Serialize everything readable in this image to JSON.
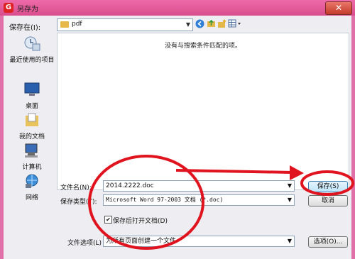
{
  "window": {
    "title": "另存为",
    "close_glyph": "✕"
  },
  "toolbar": {
    "savein_label": "保存在(I):",
    "savein_value": "pdf",
    "buttons": [
      "back-icon",
      "up-folder-icon",
      "new-folder-icon",
      "views-menu-icon"
    ]
  },
  "sidebar": {
    "items": [
      {
        "label": "最近使用的项目",
        "icon": "recent-items-icon"
      },
      {
        "label": "桌面",
        "icon": "desktop-icon"
      },
      {
        "label": "我的文档",
        "icon": "my-documents-icon"
      },
      {
        "label": "计算机",
        "icon": "computer-icon"
      },
      {
        "label": "网络",
        "icon": "network-icon"
      }
    ]
  },
  "filelist": {
    "empty_message": "没有与搜索条件匹配的项。"
  },
  "form": {
    "filename_label": "文件名(N):",
    "filename_value": "2014.2222.doc",
    "filetype_label": "保存类型(T):",
    "filetype_value": "Microsoft Word 97-2003 文档 (*.doc)",
    "open_after_save_label": "保存后打开文档(D)",
    "open_after_save_checked": true,
    "file_options_label": "文件选项(L)",
    "file_options_value": "为所有页面创建一个文件"
  },
  "buttons": {
    "save": "保存(S)",
    "cancel": "取消",
    "options": "选项(O)..."
  },
  "annotation": {
    "color": "#e0141e"
  }
}
